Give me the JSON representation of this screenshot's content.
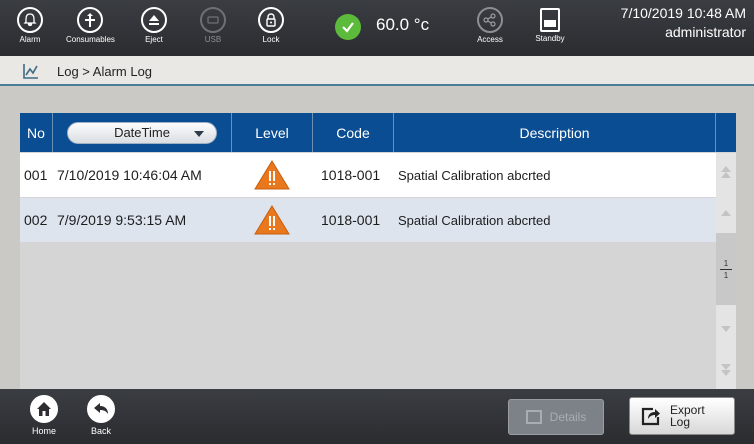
{
  "topbar": {
    "buttons": [
      {
        "label": "Alarm",
        "icon": "bell-icon"
      },
      {
        "label": "Consumables",
        "icon": "consumables-icon"
      },
      {
        "label": "Eject",
        "icon": "eject-icon"
      },
      {
        "label": "USB",
        "icon": "usb-icon"
      },
      {
        "label": "Lock",
        "icon": "lock-icon"
      },
      {
        "label": "Access",
        "icon": "share-icon"
      },
      {
        "label": "Standby",
        "icon": "standby-icon"
      }
    ],
    "temperature": "60.0 °c",
    "date_time": "7/10/2019 10:48 AM",
    "user": "administrator"
  },
  "breadcrumb": {
    "text": "Log > Alarm Log"
  },
  "table": {
    "columns": {
      "no": "No",
      "datetime": "DateTime",
      "level": "Level",
      "code": "Code",
      "description": "Description"
    },
    "rows": [
      {
        "no": "001",
        "datetime": "7/10/2019 10:46:04 AM",
        "level": "warning",
        "code": "1018-001",
        "description": "Spatial Calibration abcrted"
      },
      {
        "no": "002",
        "datetime": "7/9/2019 9:53:15 AM",
        "level": "warning",
        "code": "1018-001",
        "description": "Spatial Calibration abcrted"
      }
    ]
  },
  "pager": {
    "current": "1",
    "total": "1"
  },
  "bottombar": {
    "home_label": "Home",
    "back_label": "Back",
    "details_label": "Details",
    "export_label_1": "Export",
    "export_label_2": "Log"
  },
  "colors": {
    "header_blue": "#0b4d92",
    "warning_orange": "#e8771e",
    "ok_green": "#5dbb3b"
  }
}
